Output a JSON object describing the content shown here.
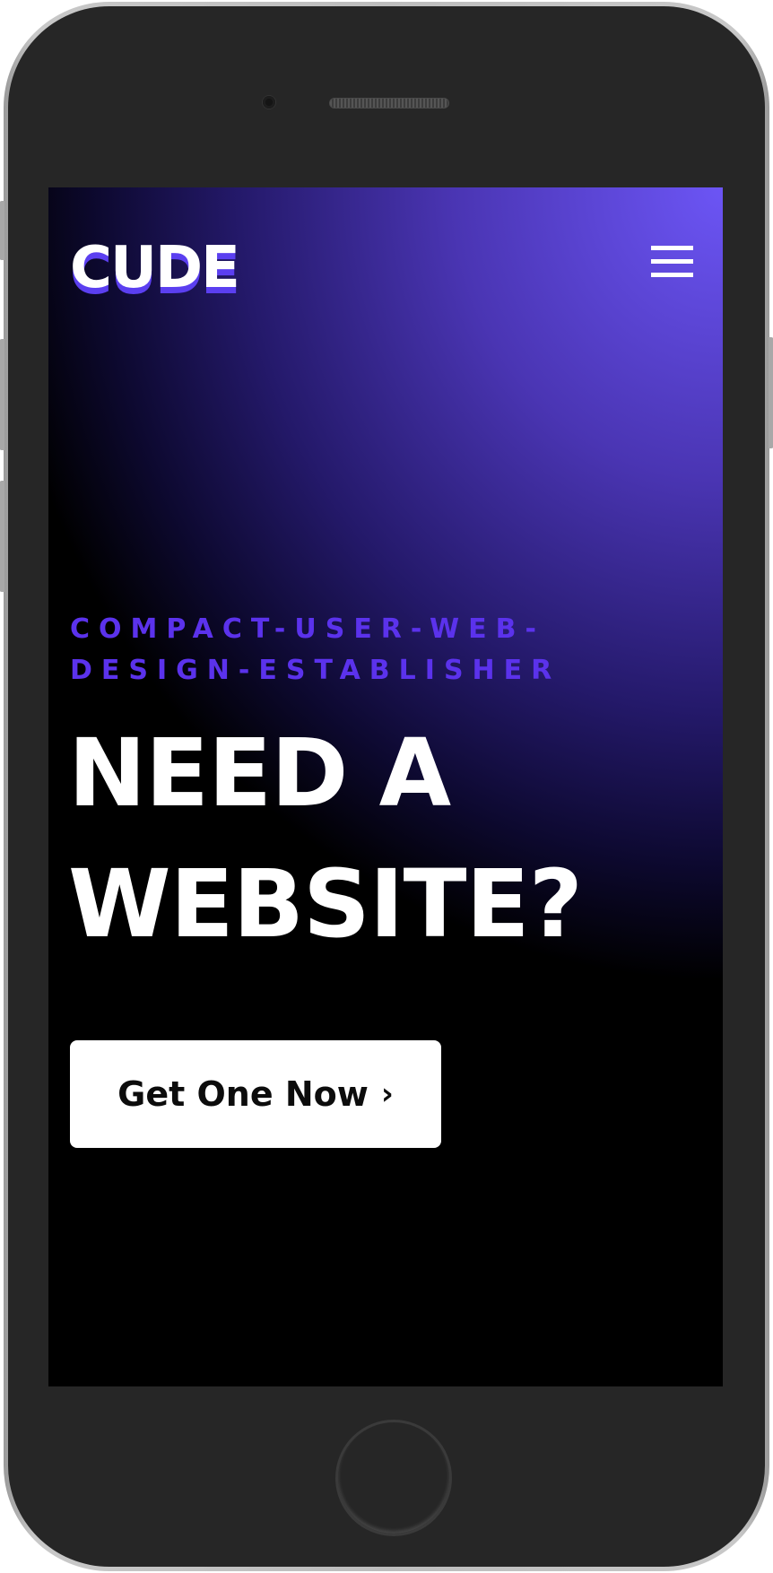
{
  "site": {
    "logo_text": "CUDE",
    "menu_icon": "hamburger-menu-icon"
  },
  "hero": {
    "tagline": "COMPACT-USER-WEB-DESIGN-ESTABLISHER",
    "headline": "NEED A WEBSITE?",
    "cta_label": "Get One Now",
    "cta_icon": "chevron-right-icon",
    "cta_icon_glyph": "›"
  },
  "colors": {
    "accent_purple": "#5b32ec",
    "gradient_light": "#6c55f5",
    "background": "#000000",
    "button_bg": "#ffffff",
    "phone_body": "#262626"
  }
}
